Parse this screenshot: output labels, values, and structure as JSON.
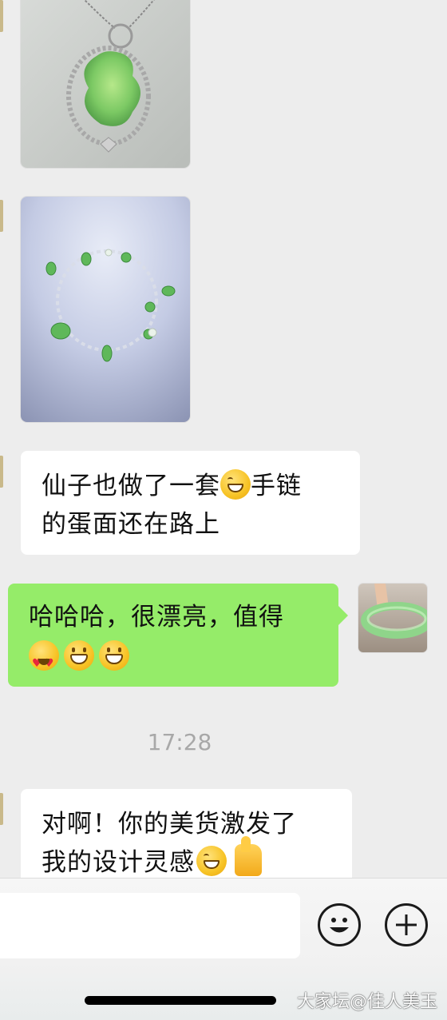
{
  "messages": {
    "msg1_lines": [
      "仙子也做了一套",
      "手链",
      "的蛋面还在路上"
    ],
    "msg2_lines": [
      "哈哈哈，很漂亮，值得"
    ],
    "timestamp": "17:28",
    "msg3_lines": [
      "对啊！你的美货激发了",
      "我的设计灵感"
    ]
  },
  "images": {
    "pendant": "jade-pendant-photo",
    "bracelet": "jade-bracelet-photo",
    "self_avatar": "jade-bangle-avatar"
  },
  "input_bar": {
    "emoji_button_icon": "emoji-face-icon",
    "plus_button_icon": "plus-circle-icon"
  },
  "watermark": "大家坛@佳人美玉",
  "colors": {
    "background": "#ededed",
    "outgoing_bubble": "#95ec69",
    "incoming_bubble": "#ffffff"
  }
}
